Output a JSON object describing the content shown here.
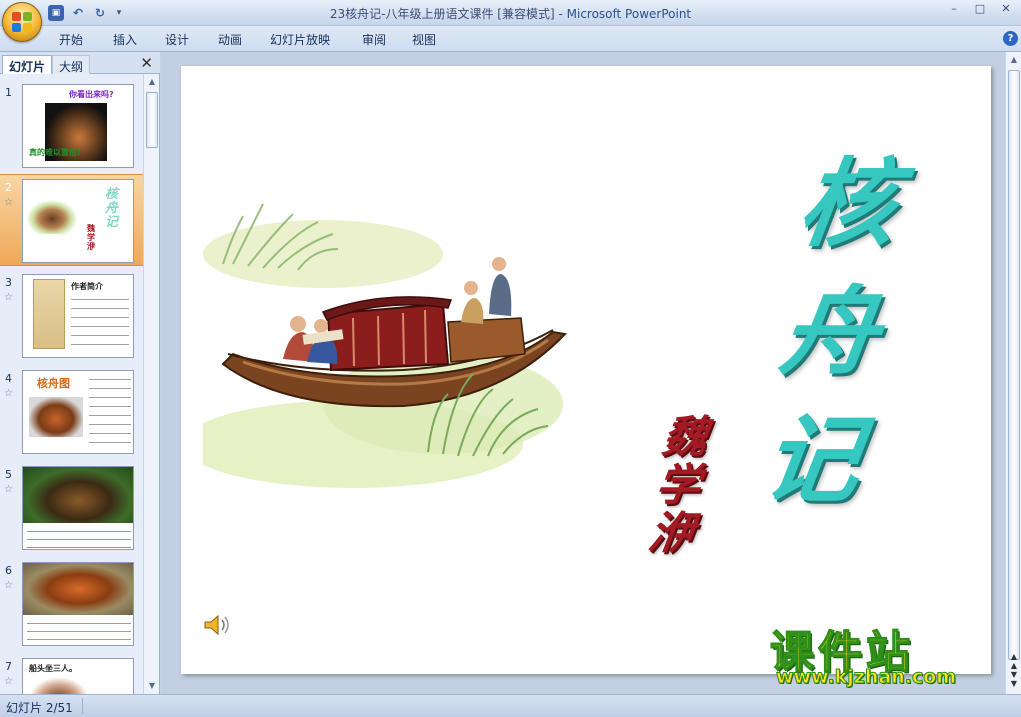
{
  "window": {
    "title": "23核舟记-八年级上册语文课件 [兼容模式]",
    "app_sep": " - ",
    "app_name": "Microsoft PowerPoint",
    "controls": [
      "–",
      "□",
      "✕"
    ]
  },
  "ribbon": {
    "tabs": [
      "开始",
      "插入",
      "设计",
      "动画",
      "幻灯片放映",
      "审阅",
      "视图"
    ],
    "help": "?"
  },
  "panel": {
    "tabs": {
      "slides": "幻灯片",
      "outline": "大纲"
    },
    "close": "✕",
    "thumbnails": [
      {
        "number": "1",
        "texts": [
          "你看出来吗?",
          "真的难以置信!"
        ]
      },
      {
        "number": "2",
        "selected": true,
        "texts": [
          "核舟记",
          "魏学洢"
        ]
      },
      {
        "number": "3",
        "texts": [
          "作者简介"
        ]
      },
      {
        "number": "4",
        "texts": [
          "核舟图"
        ]
      },
      {
        "number": "5",
        "texts": []
      },
      {
        "number": "6",
        "texts": []
      },
      {
        "number": "7",
        "texts": [
          "船头坐三人。"
        ]
      }
    ]
  },
  "slide": {
    "title": "核舟记",
    "author": "魏学洢"
  },
  "status": {
    "slide_indicator": "幻灯片 2/51"
  },
  "watermark": {
    "brand": "课件站",
    "url": "www.kjzhan.com"
  },
  "colors": {
    "title_teal": "#35c7c0",
    "author_red": "#a31a24",
    "selected_thumb": "#f0a858",
    "watermark_yellow": "#ffe21a"
  }
}
